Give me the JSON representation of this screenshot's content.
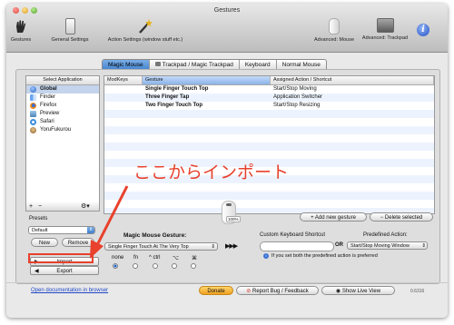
{
  "window": {
    "title": "Gestures"
  },
  "toolbar": {
    "gestures": "Gestures",
    "general": "General Settings",
    "action": "Action Settings (window stuff etc.)",
    "adv_mouse": "Advanced: Mouse",
    "adv_trackpad": "Advanced: Trackpad"
  },
  "tabs": [
    "Magic Mouse",
    "Trackpad / Magic Trackpad",
    "Keyboard",
    "Normal Mouse"
  ],
  "apps": {
    "header": "Select Application",
    "items": [
      "Global",
      "Finder",
      "Firefox",
      "Preview",
      "Safari",
      "YoruFukurou"
    ]
  },
  "table": {
    "headers": [
      "ModKeys",
      "Gesture",
      "Assigned Action / Shortcut"
    ],
    "rows": [
      {
        "gesture": "Single Finger Touch Top",
        "action": "Start/Stop Moving"
      },
      {
        "gesture": "Three Finger Tap",
        "action": "Application Switcher"
      },
      {
        "gesture": "Two Finger Touch Top",
        "action": "Start/Stop Resizing"
      }
    ]
  },
  "annotation": "ここからインポート",
  "presets": {
    "label": "Presets",
    "selected": "Default",
    "new": "New",
    "remove": "Remove",
    "import": "Import",
    "export": "Export"
  },
  "mouse_badge": "100%",
  "gesture_section": {
    "label": "Magic Mouse Gesture:",
    "selected": "Single Finger Touch At The Very Top"
  },
  "arrows": "▶▶▶",
  "shortcut": {
    "label": "Custom Keyboard Shortcut",
    "or": "OR"
  },
  "predefined": {
    "label": "Predefined Action:",
    "selected": "Start/Stop Moving Window"
  },
  "actions": {
    "add": "Add new gesture",
    "delete": "Delete selected"
  },
  "modkeys": [
    {
      "label": "none",
      "checked": true
    },
    {
      "label": "fn",
      "checked": false
    },
    {
      "label": "^ ctrl",
      "checked": false
    },
    {
      "label": "⌥",
      "checked": false
    },
    {
      "label": "⌘",
      "checked": false
    }
  ],
  "info_note": "If you set both the predefined action is preferred",
  "footer": {
    "docs_link": "Open documentation in browser",
    "donate": "Donate",
    "report": "Report Bug / Feedback",
    "live": "Show Live View",
    "version": "0.6316"
  },
  "colors": {
    "accent": "#3f7fcc",
    "annotation": "#e8412c"
  }
}
